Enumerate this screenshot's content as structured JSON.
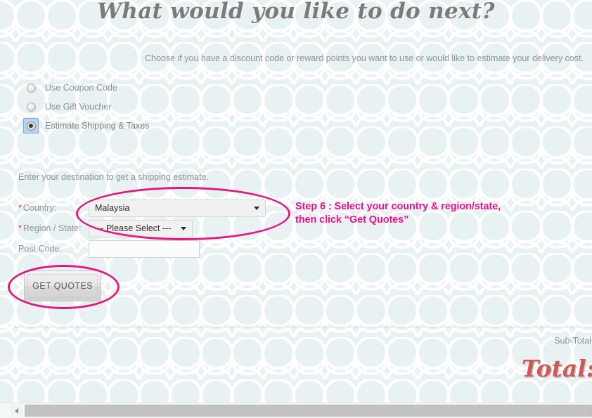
{
  "page": {
    "heading": "What would you like to do next?",
    "intro": "Choose if you have a discount code or reward points you want to use or would like to estimate your delivery cost.",
    "background_color": "#e9f2f3",
    "pattern_color": "#ffffff"
  },
  "options": [
    {
      "label": "Use Coupon Code",
      "selected": false
    },
    {
      "label": "Use Gift Voucher",
      "selected": false
    },
    {
      "label": "Estimate Shipping & Taxes",
      "selected": true
    }
  ],
  "shipping_form": {
    "hint": "Enter your destination to get a shipping estimate.",
    "required_marker": "*",
    "fields": {
      "country": {
        "label": "Country:",
        "value": "Malaysia",
        "required": true
      },
      "region": {
        "label": "Region / State:",
        "value": "--- Please Select ---",
        "required": true
      },
      "postcode": {
        "label": "Post Code:",
        "value": "",
        "placeholder": "",
        "required": false
      }
    },
    "submit_label": "GET QUOTES"
  },
  "annotation": {
    "line1": "Step 6 : Select your country & region/state,",
    "line2": "then click “Get Quotes”",
    "color": "#ec0f8c"
  },
  "totals": {
    "sub_total_label": "Sub-Total",
    "total_label": "Total:",
    "total_color": "#cf5a55"
  },
  "scrollbar": {
    "orientation": "horizontal",
    "left_arrow_icon": "caret-left-icon"
  }
}
